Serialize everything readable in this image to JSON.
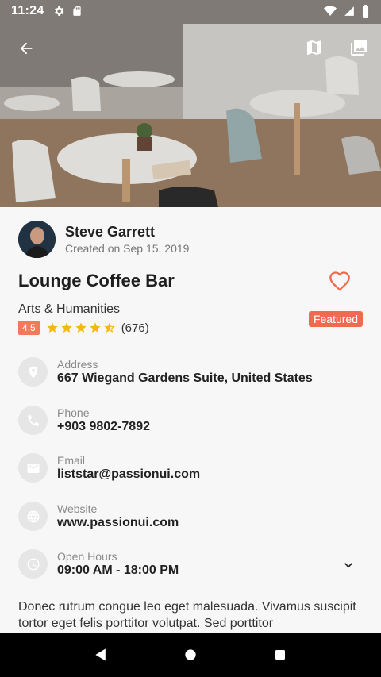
{
  "status_bar": {
    "time": "11:24"
  },
  "author": {
    "name": "Steve Garrett",
    "created": "Created on Sep 15, 2019"
  },
  "listing": {
    "title": "Lounge Coffee Bar",
    "category": "Arts & Humanities",
    "rating": "4.5",
    "rating_value": 4.5,
    "rating_count": "(676)",
    "featured_label": "Featured"
  },
  "info": {
    "address": {
      "label": "Address",
      "value": "667 Wiegand Gardens Suite, United States",
      "icon": "location-pin-icon"
    },
    "phone": {
      "label": "Phone",
      "value": "+903 9802-7892",
      "icon": "phone-icon"
    },
    "email": {
      "label": "Email",
      "value": "liststar@passionui.com",
      "icon": "email-icon"
    },
    "website": {
      "label": "Website",
      "value": "www.passionui.com",
      "icon": "globe-icon"
    },
    "hours": {
      "label": "Open Hours",
      "value": "09:00 AM - 18:00 PM",
      "icon": "clock-icon"
    }
  },
  "description": "Donec rutrum congue leo eget malesuada. Vivamus suscipit tortor eget felis porttitor volutpat. Sed porttitor",
  "colors": {
    "accent": "#ef6a4f",
    "star": "#f5b90d",
    "badge": "#f2795a"
  }
}
